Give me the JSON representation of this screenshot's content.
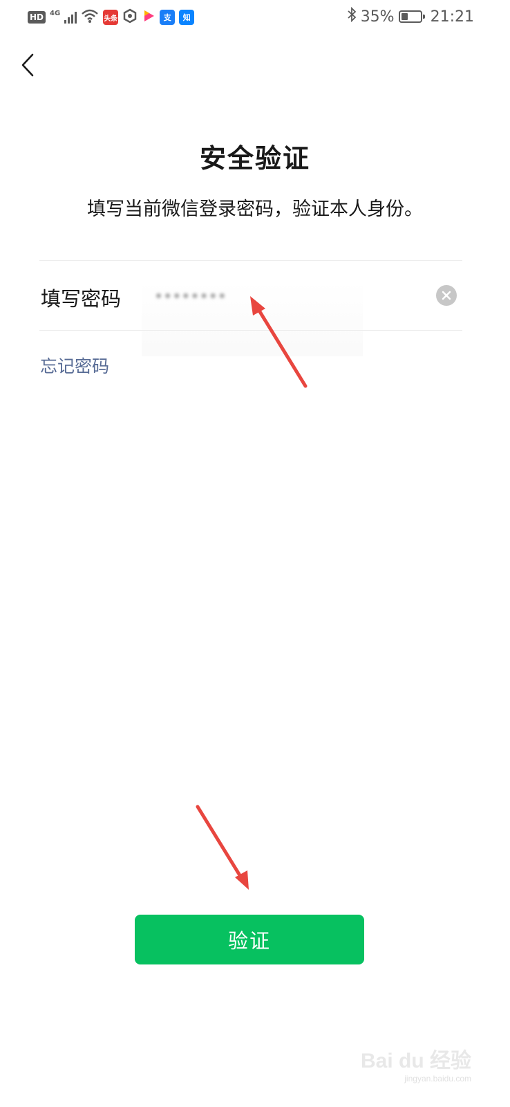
{
  "status_bar": {
    "hd": "HD",
    "network": "4G",
    "apps": [
      {
        "icon": "toutiao-icon",
        "label": "头条",
        "color": "#e53935"
      },
      {
        "icon": "hexagon-app-icon",
        "label": "",
        "color": "#5a5a5a"
      },
      {
        "icon": "video-play-icon",
        "label": "",
        "color": "#ff3d7f"
      },
      {
        "icon": "alipay-icon",
        "label": "支",
        "color": "#1a7ef7"
      },
      {
        "icon": "zhihu-icon",
        "label": "知",
        "color": "#0a84ff"
      }
    ],
    "bluetooth": "bluetooth-icon",
    "battery_percent": "35%",
    "battery_level": 0.35,
    "time": "21:21"
  },
  "header": {
    "back_icon": "chevron-left-icon"
  },
  "main": {
    "title": "安全验证",
    "subtitle": "填写当前微信登录密码，验证本人身份。",
    "password_field": {
      "label": "填写密码",
      "value": "••••••••",
      "clear_icon": "clear-icon"
    },
    "forgot_link": "忘记密码"
  },
  "footer": {
    "verify_label": "验证"
  },
  "colors": {
    "primary": "#07c160",
    "link": "#576b95",
    "annotation_arrow": "#e8463f"
  },
  "watermark": {
    "logo": "Bai du 经验",
    "url": "jingyan.baidu.com"
  }
}
